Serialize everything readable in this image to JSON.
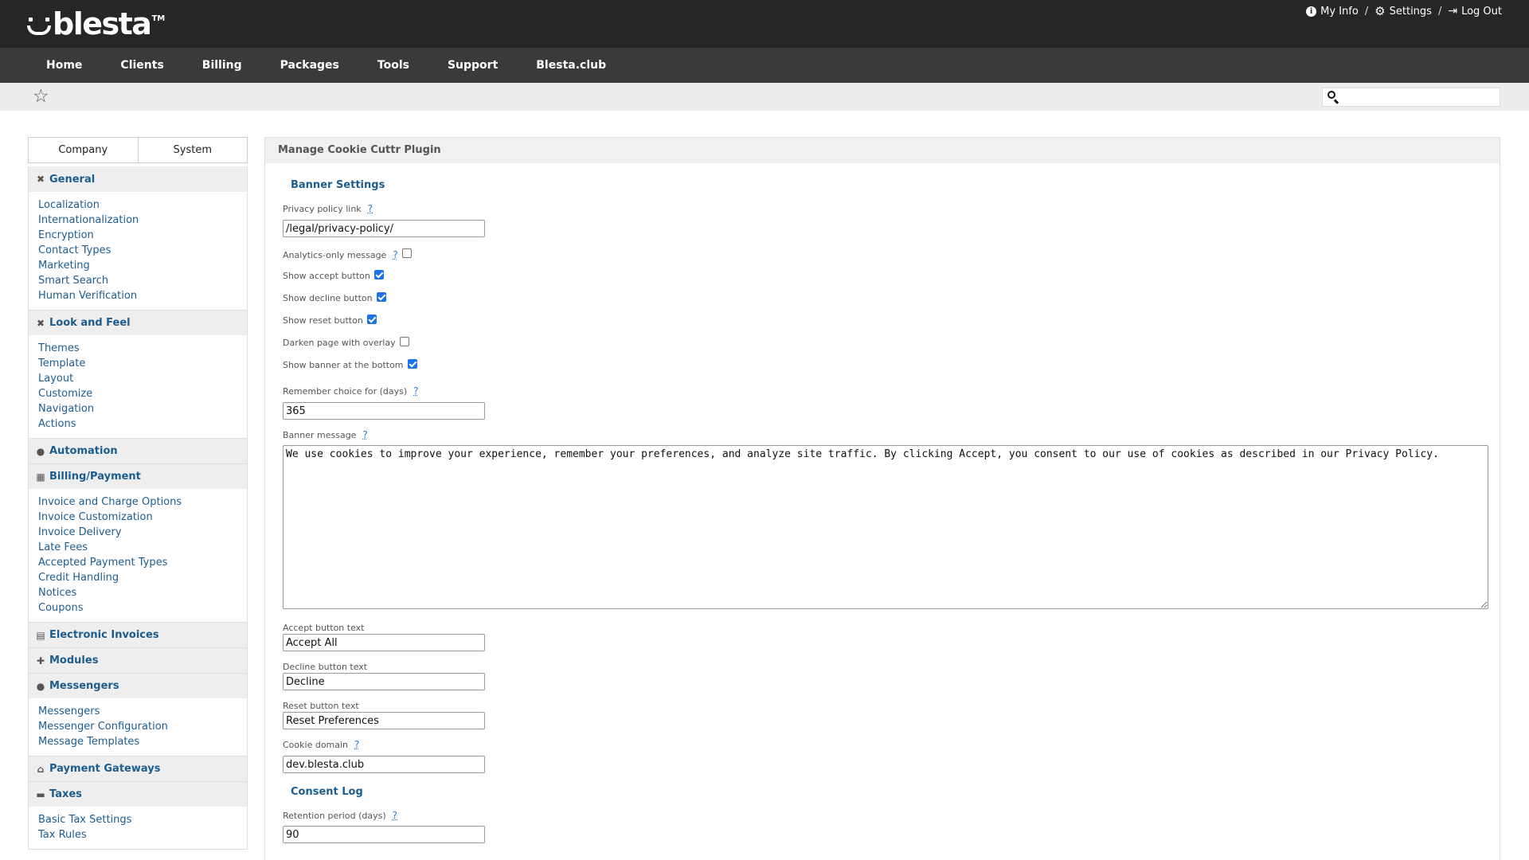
{
  "header": {
    "logo_text": "blesta",
    "logo_tm": "TM",
    "links": [
      {
        "label": "My Info",
        "icon": "info-icon"
      },
      {
        "label": "Settings",
        "icon": "gear-icon"
      },
      {
        "label": "Log Out",
        "icon": "logout-icon"
      }
    ],
    "separator": "/"
  },
  "nav": {
    "items": [
      "Home",
      "Clients",
      "Billing",
      "Packages",
      "Tools",
      "Support",
      "Blesta.club"
    ]
  },
  "subbar": {
    "star_icon": "☆",
    "search_placeholder": ""
  },
  "sidebar": {
    "tabs": [
      "Company",
      "System"
    ],
    "sections": [
      {
        "title": "General",
        "icon": "tools-icon",
        "items": [
          "Localization",
          "Internationalization",
          "Encryption",
          "Contact Types",
          "Marketing",
          "Smart Search",
          "Human Verification"
        ]
      },
      {
        "title": "Look and Feel",
        "icon": "tools-icon",
        "items": [
          "Themes",
          "Template",
          "Layout",
          "Customize",
          "Navigation",
          "Actions"
        ]
      },
      {
        "title": "Automation",
        "icon": "clock-icon",
        "items": []
      },
      {
        "title": "Billing/Payment",
        "icon": "calculator-icon",
        "items": [
          "Invoice and Charge Options",
          "Invoice Customization",
          "Invoice Delivery",
          "Late Fees",
          "Accepted Payment Types",
          "Credit Handling",
          "Notices",
          "Coupons"
        ]
      },
      {
        "title": "Electronic Invoices",
        "icon": "file-icon",
        "items": []
      },
      {
        "title": "Modules",
        "icon": "puzzle-icon",
        "items": []
      },
      {
        "title": "Messengers",
        "icon": "chat-icon",
        "items": [
          "Messengers",
          "Messenger Configuration",
          "Message Templates"
        ]
      },
      {
        "title": "Payment Gateways",
        "icon": "bank-icon",
        "items": []
      },
      {
        "title": "Taxes",
        "icon": "money-icon",
        "items": [
          "Basic Tax Settings",
          "Tax Rules"
        ]
      }
    ]
  },
  "main": {
    "title": "Manage Cookie Cuttr Plugin",
    "help_mark": "?",
    "banner_settings": {
      "title": "Banner Settings",
      "privacy_link_label": "Privacy policy link",
      "privacy_link_value": "/legal/privacy-policy/",
      "analytics_only_label": "Analytics-only message",
      "analytics_only_checked": false,
      "show_accept_label": "Show accept button",
      "show_accept_checked": true,
      "show_decline_label": "Show decline button",
      "show_decline_checked": true,
      "show_reset_label": "Show reset button",
      "show_reset_checked": true,
      "darken_label": "Darken page with overlay",
      "darken_checked": false,
      "bottom_label": "Show banner at the bottom",
      "bottom_checked": true,
      "remember_label": "Remember choice for (days)",
      "remember_value": "365",
      "message_label": "Banner message",
      "message_value": "We use cookies to improve your experience, remember your preferences, and analyze site traffic. By clicking Accept, you consent to our use of cookies as described in our Privacy Policy.",
      "accept_text_label": "Accept button text",
      "accept_text_value": "Accept All",
      "decline_text_label": "Decline button text",
      "decline_text_value": "Decline",
      "reset_text_label": "Reset button text",
      "reset_text_value": "Reset Preferences",
      "cookie_domain_label": "Cookie domain",
      "cookie_domain_value": "dev.blesta.club"
    },
    "consent_log": {
      "title": "Consent Log",
      "retention_label": "Retention period (days)",
      "retention_value": "90"
    }
  }
}
